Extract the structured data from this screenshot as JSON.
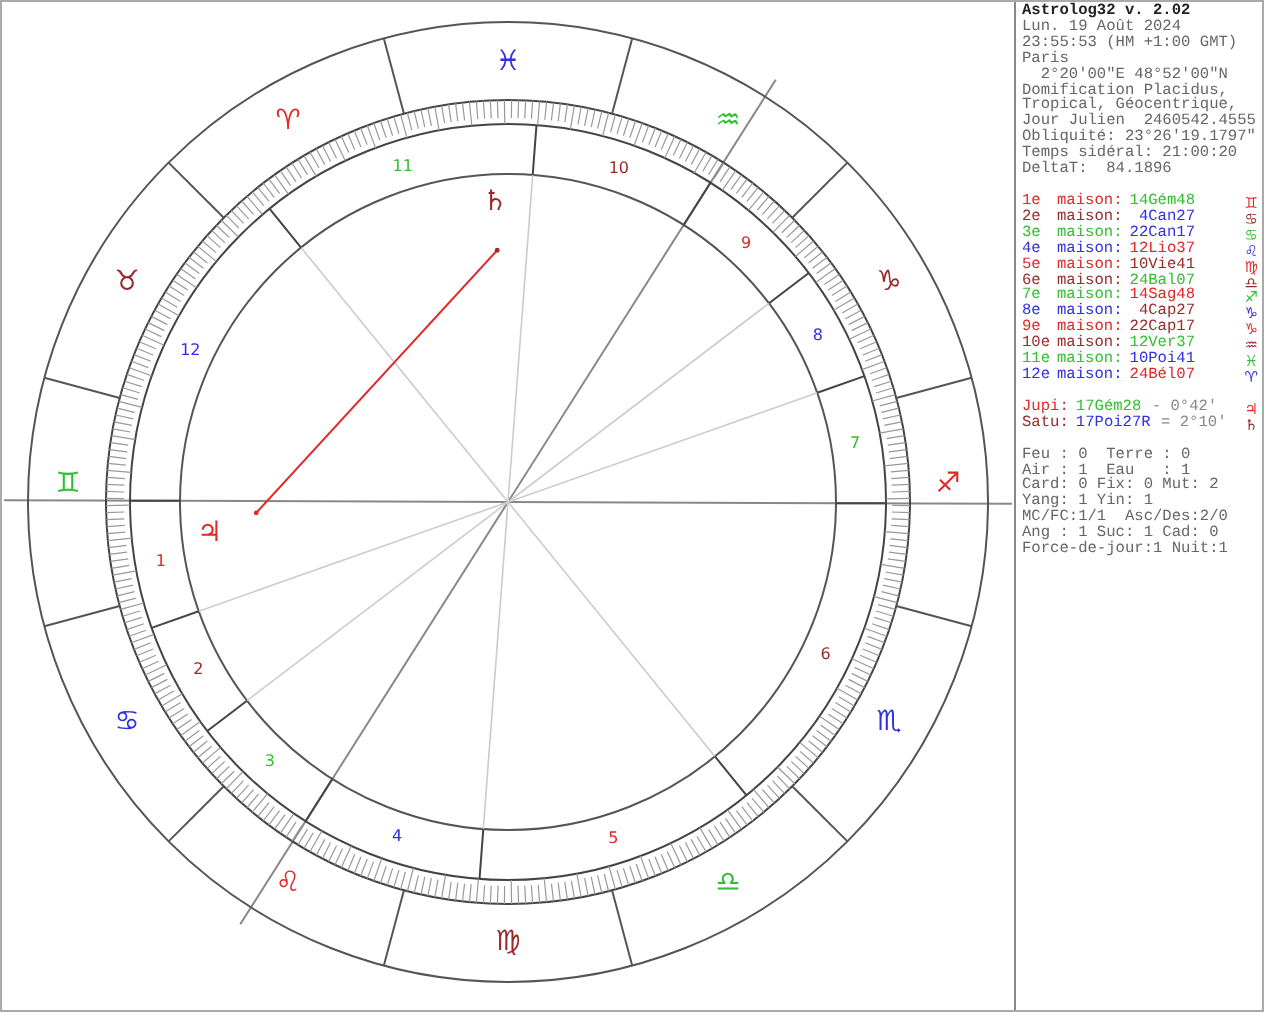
{
  "wheel": {
    "signs": [
      {
        "glyph": "♐",
        "color": "#e02828"
      },
      {
        "glyph": "♑",
        "color": "#9a2a2a"
      },
      {
        "glyph": "♒",
        "color": "#30c030"
      },
      {
        "glyph": "♓",
        "color": "#3030e0"
      },
      {
        "glyph": "♈",
        "color": "#e02828"
      },
      {
        "glyph": "♉",
        "color": "#9a2a2a"
      },
      {
        "glyph": "♊",
        "color": "#30c030"
      },
      {
        "glyph": "♋",
        "color": "#3030e0"
      },
      {
        "glyph": "♌",
        "color": "#e02828"
      },
      {
        "glyph": "♍",
        "color": "#9a2a2a"
      },
      {
        "glyph": "♎",
        "color": "#30c030"
      },
      {
        "glyph": "♏",
        "color": "#3030e0"
      }
    ],
    "house_numbers": [
      {
        "label": "1",
        "color": "#e02828"
      },
      {
        "label": "2",
        "color": "#9a2a2a"
      },
      {
        "label": "3",
        "color": "#30c030"
      },
      {
        "label": "4",
        "color": "#3030e0"
      },
      {
        "label": "5",
        "color": "#e02828"
      },
      {
        "label": "6",
        "color": "#9a2a2a"
      },
      {
        "label": "7",
        "color": "#30c030"
      },
      {
        "label": "8",
        "color": "#3030e0"
      },
      {
        "label": "9",
        "color": "#e02828"
      },
      {
        "label": "10",
        "color": "#9a2a2a"
      },
      {
        "label": "11",
        "color": "#30c030"
      },
      {
        "label": "12",
        "color": "#3030e0"
      }
    ],
    "planets": [
      {
        "glyph": "♃",
        "color": "#e02828"
      },
      {
        "glyph": "♄",
        "color": "#9a2a2a"
      }
    ]
  },
  "panel": {
    "title": "Astrolog32 v. 2.02",
    "info_lines": [
      "Lun. 19 Août 2024",
      "23:55:53 (HM +1:00 GMT)",
      "Paris",
      "  2°20'00\"E 48°52'00\"N",
      "Domification Placidus,",
      "Tropical, Géocentrique,",
      "Jour Julien  2460542.4555",
      "Obliquité: 23°26'19.1797\"",
      "Temps sidéral: 21:00:20",
      "DeltaT:  84.1896"
    ],
    "houses": [
      {
        "label": "1e",
        "word": "maison:",
        "position": {
          "text": "14Gém48",
          "color": "#30c030"
        },
        "glyph": "♊",
        "color": "#e02828"
      },
      {
        "label": "2e",
        "word": "maison:",
        "position": {
          "text": " 4Can27",
          "color": "#3030e0"
        },
        "glyph": "♋",
        "color": "#9a2a2a"
      },
      {
        "label": "3e",
        "word": "maison:",
        "position": {
          "text": "22Can17",
          "color": "#3030e0"
        },
        "glyph": "♋",
        "color": "#30c030"
      },
      {
        "label": "4e",
        "word": "maison:",
        "position": {
          "text": "12Lio37",
          "color": "#e02828"
        },
        "glyph": "♌",
        "color": "#3030e0"
      },
      {
        "label": "5e",
        "word": "maison:",
        "position": {
          "text": "10Vie41",
          "color": "#9a2a2a"
        },
        "glyph": "♍",
        "color": "#e02828"
      },
      {
        "label": "6e",
        "word": "maison:",
        "position": {
          "text": "24Bal07",
          "color": "#30c030"
        },
        "glyph": "♎",
        "color": "#9a2a2a"
      },
      {
        "label": "7e",
        "word": "maison:",
        "position": {
          "text": "14Sag48",
          "color": "#e02828"
        },
        "glyph": "♐",
        "color": "#30c030"
      },
      {
        "label": "8e",
        "word": "maison:",
        "position": {
          "text": " 4Cap27",
          "color": "#9a2a2a"
        },
        "glyph": "♑",
        "color": "#3030e0"
      },
      {
        "label": "9e",
        "word": "maison:",
        "position": {
          "text": "22Cap17",
          "color": "#9a2a2a"
        },
        "glyph": "♑",
        "color": "#e02828"
      },
      {
        "label": "10e",
        "word": "maison:",
        "position": {
          "text": "12Ver37",
          "color": "#30c030"
        },
        "glyph": "♒",
        "color": "#9a2a2a"
      },
      {
        "label": "11e",
        "word": "maison:",
        "position": {
          "text": "10Poi41",
          "color": "#3030e0"
        },
        "glyph": "♓",
        "color": "#30c030"
      },
      {
        "label": "12e",
        "word": "maison:",
        "position": {
          "text": "24Bél07",
          "color": "#e02828"
        },
        "glyph": "♈",
        "color": "#3030e0"
      }
    ],
    "planet_rows": [
      {
        "label": "Jupi:",
        "position": {
          "text": "17Gém28",
          "color": "#30c030"
        },
        "aspect": " - 0°42'",
        "glyph": "♃",
        "color": "#e02828"
      },
      {
        "label": "Satu:",
        "position": {
          "text": "17Poi27R",
          "color": "#3030e0"
        },
        "aspect": " = 2°10'",
        "glyph": "♄",
        "color": "#9a2a2a"
      }
    ],
    "stats_lines": [
      "Feu : 0  Terre : 0",
      "Air : 1  Eau   : 1",
      "Card: 0 Fix: 0 Mut: 2",
      "Yang: 1 Yin: 1",
      "MC/FC:1/1  Asc/Des:2/0",
      "Ang : 1 Suc: 1 Cad: 0",
      "Force-de-jour:1 Nuit:1"
    ]
  }
}
